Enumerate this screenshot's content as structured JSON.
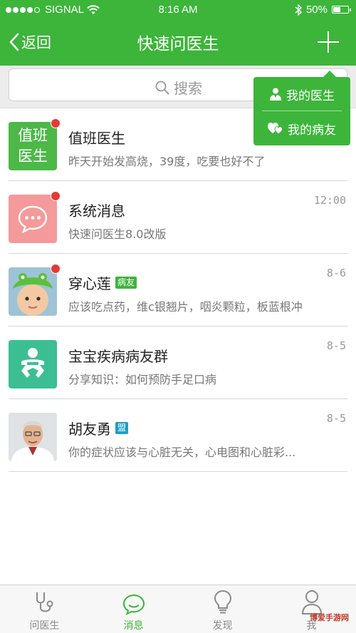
{
  "status_bar": {
    "carrier": "SIGNAL",
    "time": "8:16 AM",
    "battery": "50%",
    "battery_level": 0.5
  },
  "nav": {
    "back_label": "返回",
    "title": "快速问医生"
  },
  "search": {
    "placeholder": "搜索"
  },
  "popup_menu": {
    "items": [
      {
        "label": "我的医生",
        "icon": "doctor-icon"
      },
      {
        "label": "我的病友",
        "icon": "hearts-icon"
      }
    ]
  },
  "conversations": [
    {
      "name": "值班医生",
      "avatar_text_line1": "值班",
      "avatar_text_line2": "医生",
      "preview": "昨天开始发高烧，39度，吃要也好不了",
      "time": "",
      "unread": true
    },
    {
      "name": "系统消息",
      "preview": "快速问医生8.0改版",
      "time": "12:00",
      "unread": true,
      "icon": "chat-bubble-icon"
    },
    {
      "name": "穿心莲",
      "tag": "病友",
      "tag_color": "#3cb53a",
      "preview": "应该吃点药，维c银翘片，咽炎颗粒，板蓝根冲",
      "time": "8-6",
      "unread": true
    },
    {
      "name": "宝宝疾病病友群",
      "preview": "分享知识：如何预防手足口病",
      "time": "8-5",
      "unread": false,
      "icon": "baby-icon"
    },
    {
      "name": "胡友勇",
      "tag": "盟",
      "tag_color": "#1f9ec8",
      "preview": "你的症状应该与心脏无关，心电图和心脏彩...",
      "time": "8-5",
      "unread": false
    }
  ],
  "tabs": [
    {
      "label": "问医生",
      "icon": "stethoscope-icon",
      "active": false
    },
    {
      "label": "消息",
      "icon": "chat-icon",
      "active": true
    },
    {
      "label": "发现",
      "icon": "bulb-icon",
      "active": false
    },
    {
      "label": "我",
      "icon": "person-icon",
      "active": false
    }
  ],
  "watermark": "博爱手游网",
  "colors": {
    "brand_green": "#3cb53a",
    "unread_dot": "#e53935"
  }
}
